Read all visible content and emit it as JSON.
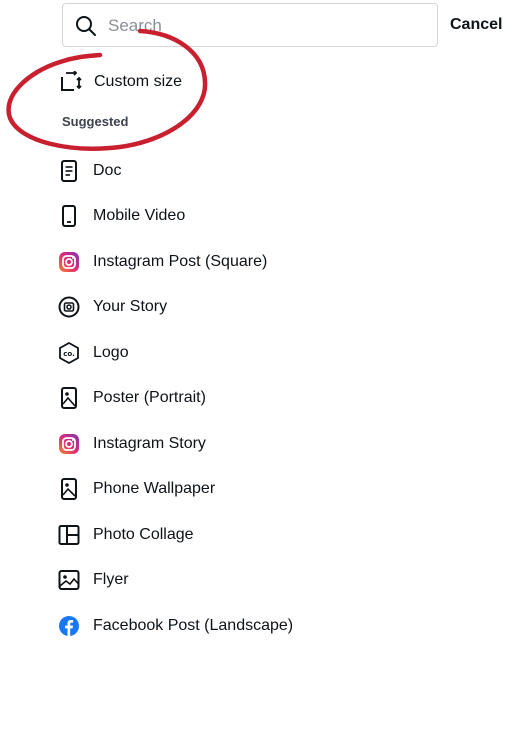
{
  "search": {
    "placeholder": "Search",
    "cancel_label": "Cancel"
  },
  "custom_size": {
    "label": "Custom size",
    "icon": "resize-icon"
  },
  "suggested": {
    "title": "Suggested",
    "items": [
      {
        "label": "Doc",
        "icon": "doc-icon"
      },
      {
        "label": "Mobile Video",
        "icon": "mobile-video-icon"
      },
      {
        "label": "Instagram Post (Square)",
        "icon": "instagram-icon"
      },
      {
        "label": "Your Story",
        "icon": "story-camera-icon"
      },
      {
        "label": "Logo",
        "icon": "logo-co-icon"
      },
      {
        "label": "Poster (Portrait)",
        "icon": "poster-icon"
      },
      {
        "label": "Instagram Story",
        "icon": "instagram-icon"
      },
      {
        "label": "Phone Wallpaper",
        "icon": "phone-wallpaper-icon"
      },
      {
        "label": "Photo Collage",
        "icon": "collage-icon"
      },
      {
        "label": "Flyer",
        "icon": "flyer-icon"
      },
      {
        "label": "Facebook Post (Landscape)",
        "icon": "facebook-icon"
      }
    ]
  },
  "colors": {
    "annotation": "#c8202f",
    "facebook": "#1877f2",
    "instagram_start": "#f58529",
    "instagram_end": "#dd2a7b"
  }
}
